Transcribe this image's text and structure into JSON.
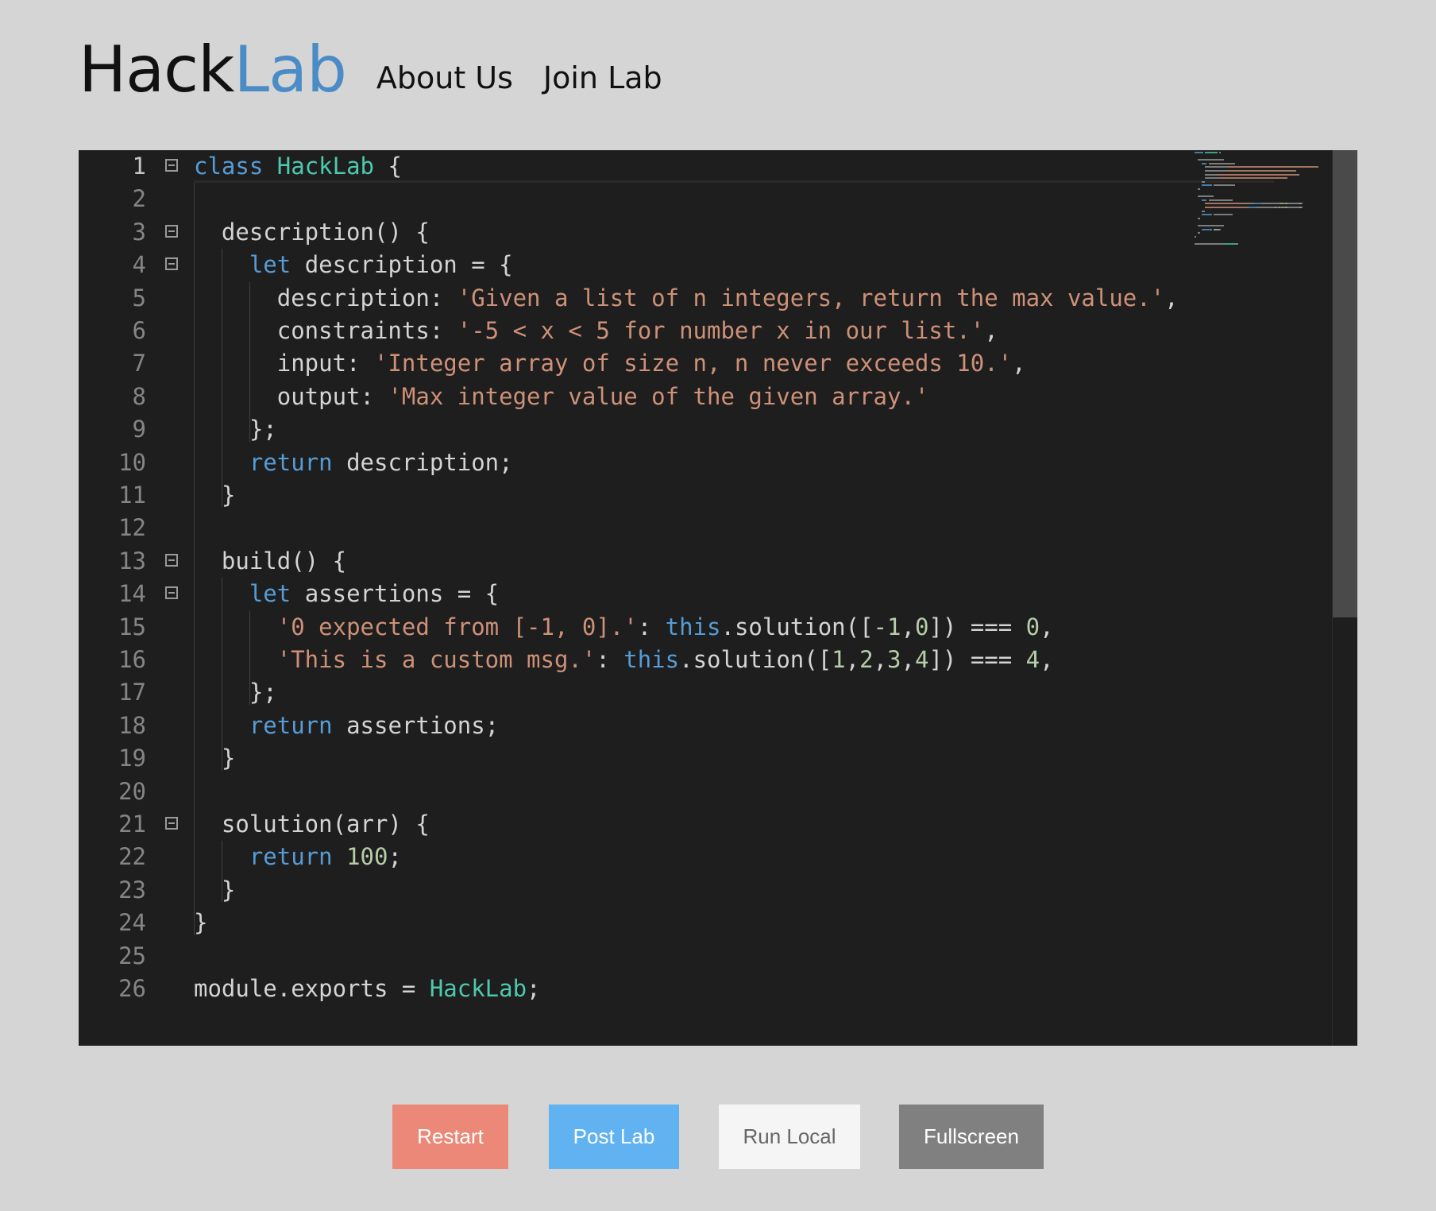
{
  "header": {
    "logo_part1": "Hack",
    "logo_part2": "Lab",
    "nav": [
      "About Us",
      "Join Lab"
    ]
  },
  "editor": {
    "language": "javascript",
    "active_line": 1,
    "folded_markers_at_lines": [
      1,
      3,
      4,
      13,
      14,
      21
    ],
    "lines": [
      [
        {
          "t": "kw",
          "v": "class"
        },
        {
          "t": "",
          "v": " "
        },
        {
          "t": "cls",
          "v": "HackLab"
        },
        {
          "t": "",
          "v": " {"
        }
      ],
      [],
      [
        {
          "t": "",
          "v": "  description() {"
        }
      ],
      [
        {
          "t": "",
          "v": "    "
        },
        {
          "t": "kw",
          "v": "let"
        },
        {
          "t": "",
          "v": " description = {"
        }
      ],
      [
        {
          "t": "",
          "v": "      description: "
        },
        {
          "t": "str",
          "v": "'Given a list of n integers, return the max value.'"
        },
        {
          "t": "",
          "v": ","
        }
      ],
      [
        {
          "t": "",
          "v": "      constraints: "
        },
        {
          "t": "str",
          "v": "'-5 < x < 5 for number x in our list.'"
        },
        {
          "t": "",
          "v": ","
        }
      ],
      [
        {
          "t": "",
          "v": "      input: "
        },
        {
          "t": "str",
          "v": "'Integer array of size n, n never exceeds 10.'"
        },
        {
          "t": "",
          "v": ","
        }
      ],
      [
        {
          "t": "",
          "v": "      output: "
        },
        {
          "t": "str",
          "v": "'Max integer value of the given array.'"
        }
      ],
      [
        {
          "t": "",
          "v": "    };"
        }
      ],
      [
        {
          "t": "",
          "v": "    "
        },
        {
          "t": "kw",
          "v": "return"
        },
        {
          "t": "",
          "v": " description;"
        }
      ],
      [
        {
          "t": "",
          "v": "  }"
        }
      ],
      [],
      [
        {
          "t": "",
          "v": "  build() {"
        }
      ],
      [
        {
          "t": "",
          "v": "    "
        },
        {
          "t": "kw",
          "v": "let"
        },
        {
          "t": "",
          "v": " assertions = {"
        }
      ],
      [
        {
          "t": "",
          "v": "      "
        },
        {
          "t": "str",
          "v": "'0 expected from [-1, 0].'"
        },
        {
          "t": "",
          "v": ": "
        },
        {
          "t": "kw",
          "v": "this"
        },
        {
          "t": "",
          "v": ".solution(["
        },
        {
          "t": "num",
          "v": "-1"
        },
        {
          "t": "",
          "v": ","
        },
        {
          "t": "num",
          "v": "0"
        },
        {
          "t": "",
          "v": "]) === "
        },
        {
          "t": "num",
          "v": "0"
        },
        {
          "t": "",
          "v": ","
        }
      ],
      [
        {
          "t": "",
          "v": "      "
        },
        {
          "t": "str",
          "v": "'This is a custom msg.'"
        },
        {
          "t": "",
          "v": ": "
        },
        {
          "t": "kw",
          "v": "this"
        },
        {
          "t": "",
          "v": ".solution(["
        },
        {
          "t": "num",
          "v": "1"
        },
        {
          "t": "",
          "v": ","
        },
        {
          "t": "num",
          "v": "2"
        },
        {
          "t": "",
          "v": ","
        },
        {
          "t": "num",
          "v": "3"
        },
        {
          "t": "",
          "v": ","
        },
        {
          "t": "num",
          "v": "4"
        },
        {
          "t": "",
          "v": "]) === "
        },
        {
          "t": "num",
          "v": "4"
        },
        {
          "t": "",
          "v": ","
        }
      ],
      [
        {
          "t": "",
          "v": "    };"
        }
      ],
      [
        {
          "t": "",
          "v": "    "
        },
        {
          "t": "kw",
          "v": "return"
        },
        {
          "t": "",
          "v": " assertions;"
        }
      ],
      [
        {
          "t": "",
          "v": "  }"
        }
      ],
      [],
      [
        {
          "t": "",
          "v": "  solution(arr) {"
        }
      ],
      [
        {
          "t": "",
          "v": "    "
        },
        {
          "t": "kw",
          "v": "return"
        },
        {
          "t": "",
          "v": " "
        },
        {
          "t": "num",
          "v": "100"
        },
        {
          "t": "",
          "v": ";"
        }
      ],
      [
        {
          "t": "",
          "v": "  }"
        }
      ],
      [
        {
          "t": "",
          "v": "}"
        }
      ],
      [],
      [
        {
          "t": "",
          "v": "module.exports = "
        },
        {
          "t": "cls",
          "v": "HackLab"
        },
        {
          "t": "",
          "v": ";"
        }
      ]
    ]
  },
  "buttons": {
    "restart": "Restart",
    "post": "Post Lab",
    "run": "Run Local",
    "fullscreen": "Fullscreen"
  },
  "colors": {
    "keyword": "#569cd6",
    "class": "#4ec9b0",
    "string": "#ce9178",
    "number": "#b5cea8",
    "text": "#d4d4d4",
    "logo_accent": "#4b8cc6",
    "restart_bg": "#eb8877",
    "post_bg": "#60b2f1",
    "run_bg": "#f5f5f5",
    "fullscreen_bg": "#808080"
  }
}
